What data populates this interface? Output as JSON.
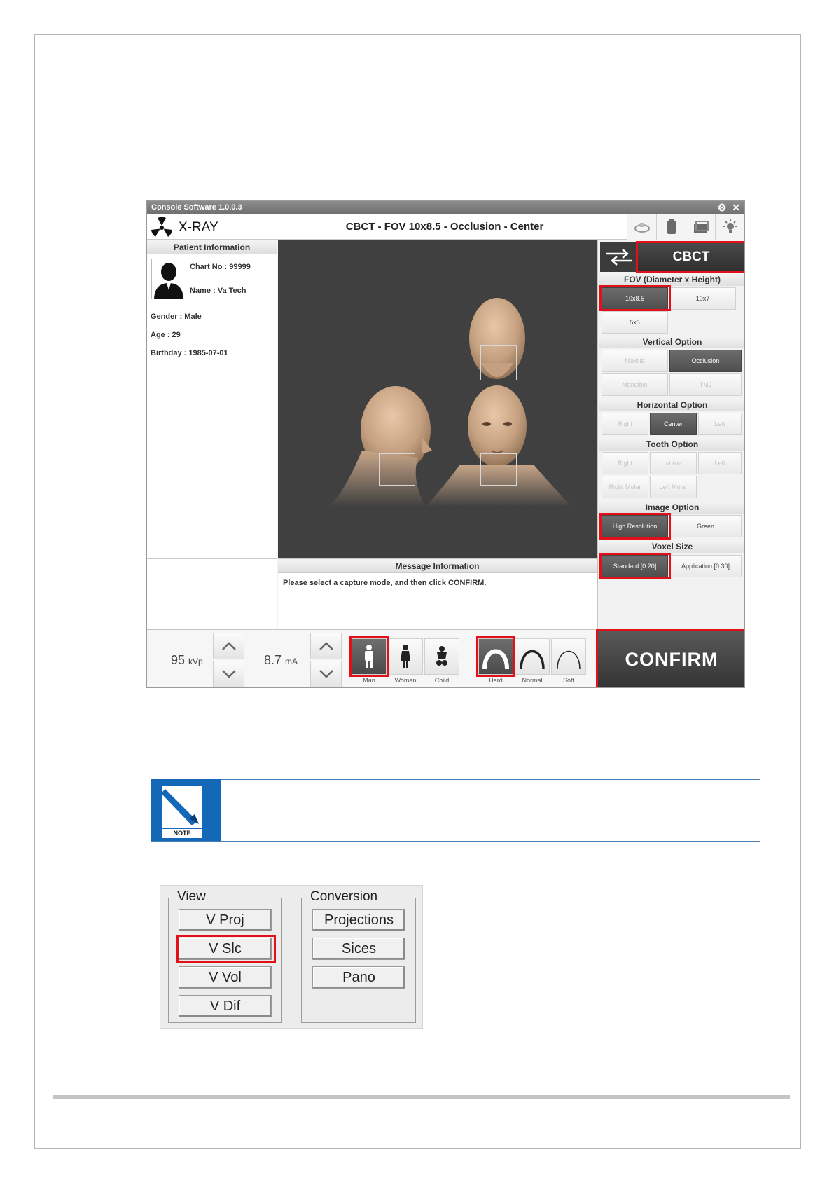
{
  "console": {
    "window_title": "Console Software  1.0.0.3",
    "app_title": "X-RAY",
    "mode_title": "CBCT - FOV 10x8.5 - Occlusion - Center",
    "titlebar_icons": [
      "gear-icon",
      "close-icon"
    ],
    "header_icons": [
      "scan-icon",
      "sensor-icon",
      "cassette-icon",
      "light-icon"
    ]
  },
  "patient": {
    "heading": "Patient Information",
    "chart_no": "Chart No : 99999",
    "name": "Name : Va Tech",
    "gender": "Gender : Male",
    "age": "Age : 29",
    "birthday": "Birthday : 1985-07-01"
  },
  "right_panel": {
    "mode_button": "CBCT",
    "fov": {
      "label": "FOV (Diameter x Height)",
      "opt1": "10x8.5",
      "opt2": "10x7",
      "opt3": "5x5"
    },
    "vertical": {
      "label": "Vertical Option",
      "maxilla": "Maxilla",
      "occlusion": "Occlusion",
      "mandible": "Mandible",
      "tmj": "TMJ"
    },
    "horizontal": {
      "label": "Horizontal Option",
      "right": "Right",
      "center": "Center",
      "left": "Left"
    },
    "tooth": {
      "label": "Tooth Option",
      "right": "Right",
      "incisor": "Incisor",
      "left": "Left",
      "right_molar": "Right Molar",
      "left_molar": "Left Molar"
    },
    "image": {
      "label": "Image Option",
      "high": "High Resolution",
      "green": "Green"
    },
    "voxel": {
      "label": "Voxel Size",
      "standard": "Standard  [0.20]",
      "application": "Application [0.30]"
    }
  },
  "message": {
    "heading": "Message Information",
    "text": "Please select a capture mode, and then click CONFIRM."
  },
  "controls": {
    "kvp_value": "95",
    "kvp_unit": "kVp",
    "ma_value": "8.7",
    "ma_unit": "mA",
    "patient_types": {
      "man": "Man",
      "woman": "Woman",
      "child": "Child"
    },
    "arch_types": {
      "hard": "Hard",
      "normal": "Normal",
      "soft": "Soft"
    },
    "confirm": "CONFIRM"
  },
  "note": {
    "label": "NOTE"
  },
  "lower_panel": {
    "view": {
      "title": "View",
      "proj": "V Proj",
      "slc": "V Slc",
      "vol": "V Vol",
      "dif": "V Dif"
    },
    "conversion": {
      "title": "Conversion",
      "projections": "Projections",
      "sices": "Sices",
      "pano": "Pano"
    }
  },
  "colors": {
    "highlight": "#e3101a",
    "note_blue": "#1468b8",
    "viewer_bg": "#404040"
  }
}
